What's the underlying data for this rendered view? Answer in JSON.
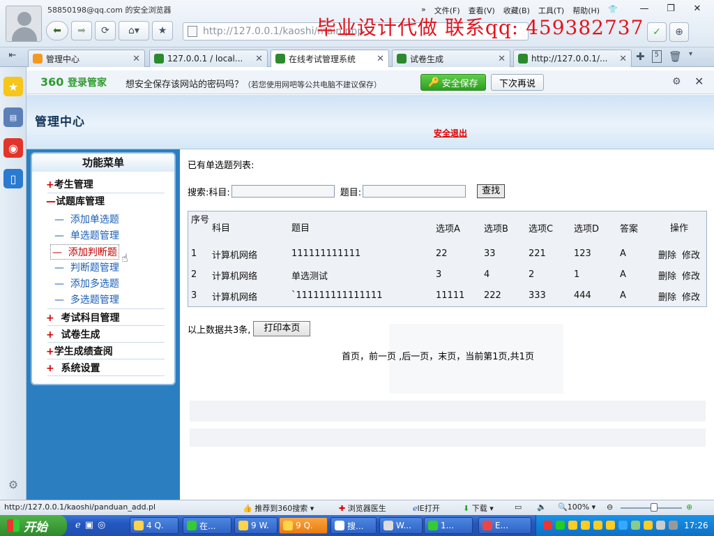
{
  "browser": {
    "account": "58850198@qq.com 的安全浏览器",
    "url": "http://127.0.0.1/kaoshi/main.php",
    "menu": [
      "文件(F)",
      "查看(V)",
      "收藏(B)",
      "工具(T)",
      "帮助(H)"
    ],
    "watermark": "毕业设计代做 联系qq: 459382737"
  },
  "tabs": [
    {
      "label": "管理中心",
      "active": false
    },
    {
      "label": "127.0.0.1 / local...",
      "active": false
    },
    {
      "label": "在线考试管理系统",
      "active": true
    },
    {
      "label": "试卷生成",
      "active": false
    },
    {
      "label": "http://127.0.0.1/...",
      "active": false
    }
  ],
  "tab_count": "5",
  "password_bar": {
    "logo_num": "360",
    "logo_text": "登录管家",
    "message": "想安全保存该网站的密码吗？",
    "hint": "（若您使用网吧等公共电脑不建议保存）",
    "save_label": "安全保存",
    "later_label": "下次再说"
  },
  "header": {
    "title": "管理中心",
    "logout": "安全退出"
  },
  "menu": {
    "title": "功能菜单",
    "items": [
      {
        "sym": "+",
        "label": "考生管理"
      },
      {
        "sym": "—",
        "label": "试题库管理"
      },
      {
        "sym": "—",
        "label": "添加单选题"
      },
      {
        "sym": "—",
        "label": "单选题管理"
      },
      {
        "sym": "—",
        "label": "添加判断题"
      },
      {
        "sym": "—",
        "label": "判断题管理"
      },
      {
        "sym": "—",
        "label": "添加多选题"
      },
      {
        "sym": "—",
        "label": "多选题管理"
      },
      {
        "sym": "+",
        "label": "考试科目管理"
      },
      {
        "sym": "+",
        "label": "试卷生成"
      },
      {
        "sym": "+",
        "label": "学生成绩查阅"
      },
      {
        "sym": "+",
        "label": "系统设置"
      }
    ]
  },
  "content": {
    "list_title": "已有单选题列表:",
    "search_label": "搜索:科目:",
    "topic_label": "题目:",
    "search_button": "查找",
    "columns": [
      "序号",
      "科目",
      "题目",
      "选项A",
      "选项B",
      "选项C",
      "选项D",
      "答案",
      "操作"
    ],
    "rows": [
      {
        "id": "1",
        "subject": "计算机网络",
        "title": "111111111111",
        "a": "22",
        "b": "33",
        "c": "221",
        "d": "123",
        "answer": "A"
      },
      {
        "id": "2",
        "subject": "计算机网络",
        "title": "单选测试",
        "a": "3",
        "b": "4",
        "c": "2",
        "d": "1",
        "answer": "A"
      },
      {
        "id": "3",
        "subject": "计算机网络",
        "title": "`111111111111111",
        "a": "11111",
        "b": "222",
        "c": "333",
        "d": "444",
        "answer": "A"
      }
    ],
    "delete_label": "删除",
    "edit_label": "修改",
    "summary": "以上数据共3条,",
    "print_button": "打印本页",
    "pager": "首页，前一页 ,后一页，末页，当前第1页,共1页"
  },
  "statusbar": {
    "link": "http://127.0.0.1/kaoshi/panduan_add.pl",
    "recommend": "推荐到360搜索",
    "doctor": "浏览器医生",
    "ie": "IE打开",
    "download": "下载",
    "zoom": "100%",
    "zoom_level": 0.55
  },
  "taskbar": {
    "start": "开始",
    "buttons": [
      "4 Q.",
      "在...",
      "9 W.",
      "9 Q.",
      "搜...",
      "W...",
      "1...",
      "E..."
    ],
    "clock": "17:26"
  }
}
